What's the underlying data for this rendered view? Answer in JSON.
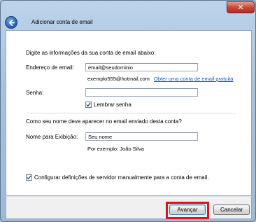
{
  "window": {
    "title": "Adicionar conta de email",
    "close_glyph": "✕"
  },
  "form": {
    "intro": "Digite as informações da sua conta de email abaixo:",
    "email_label": "Endereço de email:",
    "email_value": "email@seudominio",
    "email_example": "exemplo555@hotmail.com",
    "free_account_link": "Obter uma conta de email gratuita",
    "password_label": "Senha:",
    "password_value": "",
    "remember_label": "Lembrar senha",
    "remember_checked": true,
    "name_question": "Como seu nome deve aparecer no email enviado desta conta?",
    "display_name_label": "Nome para Exibição:",
    "display_name_value": "Seu nome",
    "display_name_example": "Por exemplo: João Silva",
    "manual_config_label": "Configurar definições de servidor manualmente para a conta de email.",
    "manual_config_checked": true
  },
  "buttons": {
    "next": "Avançar",
    "cancel": "Cancelar"
  },
  "colors": {
    "link": "#0b5bc7",
    "highlight": "#e0121b"
  }
}
